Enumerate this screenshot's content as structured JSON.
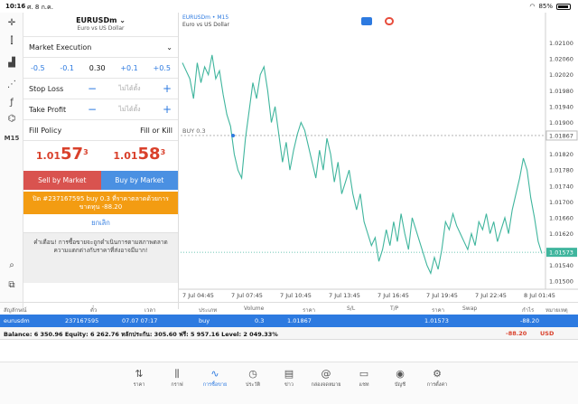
{
  "status": {
    "time": "10:16",
    "date": "ศ. 8 ก.ค.",
    "battery": "85%"
  },
  "symbol": {
    "name": "EURUSDm",
    "desc": "Euro vs US Dollar"
  },
  "execution": "Market Execution",
  "volume": {
    "m2": "-0.5",
    "m1": "-0.1",
    "value": "0.30",
    "p1": "+0.1",
    "p2": "+0.5"
  },
  "stop_loss": {
    "label": "Stop Loss",
    "placeholder": "ไม่ได้ตั้ง"
  },
  "take_profit": {
    "label": "Take Profit",
    "placeholder": "ไม่ได้ตั้ง"
  },
  "fill_policy": {
    "label": "Fill Policy",
    "value": "Fill or Kill"
  },
  "bid": {
    "small": "1.01",
    "big": "57",
    "sup": "3"
  },
  "ask": {
    "small": "1.01",
    "big": "58",
    "sup": "3"
  },
  "sell_label": "Sell by Market",
  "buy_label": "Buy by Market",
  "close_order": {
    "line1": "ปิด #237167595 buy 0.3 ที่ราคาตลาดด้วยการ",
    "line2": "ขาดทุน -88.20"
  },
  "cancel_label": "ยกเลิก",
  "warning": "คำเตือน! การซื้อขายจะถูกดำเนินการตามสภาพตลาด ความแตกต่างกับราคาที่ส่งอาจมีมาก!",
  "chart_header": {
    "title": "EURUSDm • M15",
    "subtitle": "Euro vs US Dollar"
  },
  "chart_data": {
    "type": "line",
    "title": "",
    "y_ticks": [
      "1.02100",
      "1.02060",
      "1.02020",
      "1.01980",
      "1.01940",
      "1.01900",
      "1.01867",
      "1.01820",
      "1.01780",
      "1.01740",
      "1.01700",
      "1.01660",
      "1.01620",
      "1.01573",
      "1.01540",
      "1.01500"
    ],
    "x_ticks": [
      "7 Jul 04:45",
      "7 Jul 07:45",
      "7 Jul 10:45",
      "7 Jul 13:45",
      "7 Jul 16:45",
      "7 Jul 19:45",
      "7 Jul 22:45",
      "8 Jul 01:45"
    ],
    "ylim": [
      1.0148,
      1.0214
    ],
    "buy_level": 1.01867,
    "buy_label": "BUY 0.3",
    "current_price": 1.01573,
    "series": [
      {
        "values": [
          1.0205,
          1.0203,
          1.0201,
          1.0196,
          1.0205,
          1.02,
          1.0204,
          1.0202,
          1.0207,
          1.0201,
          1.0203,
          1.0197,
          1.0192,
          1.0189,
          1.0182,
          1.0178,
          1.0176,
          1.0186,
          1.0193,
          1.02,
          1.0196,
          1.0202,
          1.0204,
          1.0198,
          1.019,
          1.0194,
          1.0187,
          1.018,
          1.0185,
          1.0178,
          1.0183,
          1.0187,
          1.019,
          1.0188,
          1.0184,
          1.018,
          1.0176,
          1.0183,
          1.0178,
          1.0186,
          1.0182,
          1.0175,
          1.018,
          1.0172,
          1.0175,
          1.0178,
          1.0172,
          1.0168,
          1.0172,
          1.0165,
          1.0162,
          1.0159,
          1.0161,
          1.0155,
          1.0158,
          1.0163,
          1.0159,
          1.0165,
          1.016,
          1.0167,
          1.0162,
          1.0158,
          1.0166,
          1.0163,
          1.016,
          1.0157,
          1.0154,
          1.0152,
          1.0156,
          1.0153,
          1.0158,
          1.0165,
          1.0163,
          1.0167,
          1.0164,
          1.0162,
          1.016,
          1.0158,
          1.0162,
          1.0159,
          1.0165,
          1.0163,
          1.0167,
          1.0162,
          1.0165,
          1.016,
          1.0163,
          1.0166,
          1.0162,
          1.0168,
          1.0172,
          1.0176,
          1.0181,
          1.0178,
          1.0171,
          1.0166,
          1.016,
          1.0157
        ]
      }
    ]
  },
  "table": {
    "headers": [
      "สัญลักษณ์",
      "ตั๋ว",
      "เวลา",
      "ประเภท",
      "Volume",
      "ราคา",
      "S/L",
      "T/P",
      "ราคา",
      "Swap",
      "กำไร",
      "หมายเหตุ"
    ],
    "row": {
      "symbol": "eurusdm",
      "ticket": "237167595",
      "time": "07.07 07:17",
      "type": "buy",
      "volume": "0.3",
      "open_price": "1.01867",
      "price": "1.01573",
      "profit": "-88.20"
    }
  },
  "balance": {
    "text": "Balance: 6 350.96 Equity: 6 262.76 หลักประกัน: 305.60 ฟรี: 5 957.16 Level: 2 049.33%",
    "pnl": "-88.20",
    "currency": "USD"
  },
  "tabs": [
    {
      "label": "ราคา",
      "icon": "⇅"
    },
    {
      "label": "กราฟ",
      "icon": "⫼"
    },
    {
      "label": "การซื้อขาย",
      "icon": "∿"
    },
    {
      "label": "ประวัติ",
      "icon": "◷"
    },
    {
      "label": "ข่าว",
      "icon": "▤"
    },
    {
      "label": "กล่องจดหมาย",
      "icon": "@"
    },
    {
      "label": "แชท",
      "icon": "▭"
    },
    {
      "label": "บัญชี",
      "icon": "◉"
    },
    {
      "label": "การตั้งค่า",
      "icon": "⚙"
    }
  ],
  "colors": {
    "accent": "#2d7ae0",
    "sell": "#d9534f",
    "buy": "#4a90e2",
    "close": "#f39c12",
    "line": "#3fb59d",
    "price": "#d9402b"
  }
}
